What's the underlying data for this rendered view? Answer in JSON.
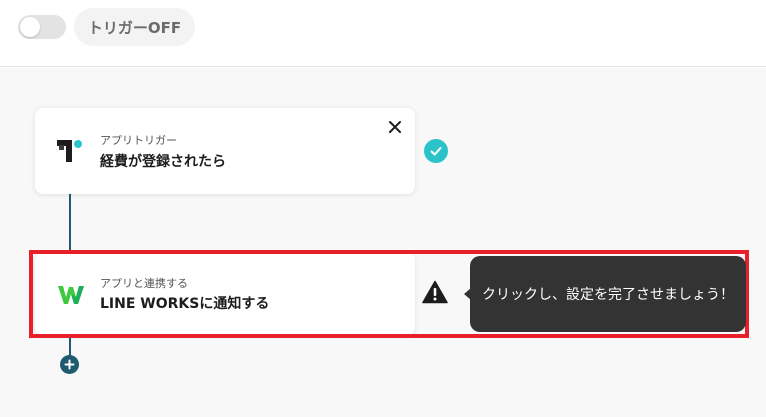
{
  "header": {
    "trigger_toggle": {
      "state": "off"
    },
    "trigger_label": "トリガーOFF"
  },
  "flow": {
    "steps": [
      {
        "type_label": "アプリトリガー",
        "title": "経費が登録されたら",
        "icon": "trigger-app-logo-icon",
        "status": "complete"
      },
      {
        "type_label": "アプリと連携する",
        "title": "LINE WORKSに通知する",
        "icon": "line-works-logo-icon",
        "status": "warning"
      }
    ],
    "tooltip": "クリックし、設定を完了させましょう！"
  },
  "colors": {
    "accent_teal": "#2bc3c9",
    "connector": "#1f5a6e",
    "highlight": "#e8202a",
    "tooltip_bg": "#333333",
    "line_works_green": "#3ec93e"
  }
}
